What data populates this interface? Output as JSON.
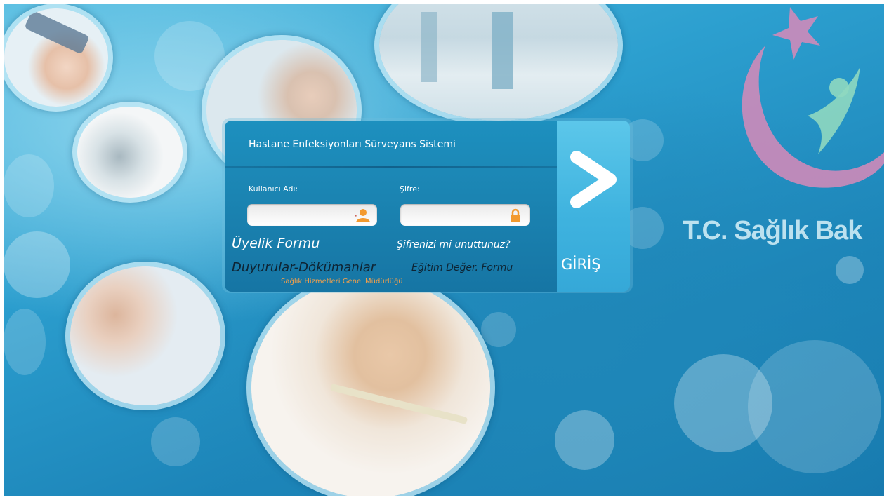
{
  "panel": {
    "title": "Hastane Enfeksiyonları Sürveyans Sistemi",
    "username_label": "Kullanıcı Adı:",
    "password_label": "Şifre:",
    "username_value": "",
    "password_value": "",
    "submit_label": "GİRİŞ"
  },
  "links": {
    "membership": "Üyelik Formu",
    "forgot_password": "Şifrenizi mi unuttunuz?",
    "announcements": "Duyurular-Dökümanlar",
    "training": "Eğitim Değer. Formu",
    "directorate": "Sağlık Hizmetleri Genel Müdürlüğü"
  },
  "brand": {
    "text": "T.C. Sağlık Bak"
  },
  "icons": {
    "username": "user-icon",
    "password": "lock-icon",
    "submit": "chevron-right-icon"
  },
  "colors": {
    "accent": "#f5a04a",
    "panel": "#1b84b2",
    "submit": "#3fb3df",
    "logo_crescent": "#d889b8"
  }
}
